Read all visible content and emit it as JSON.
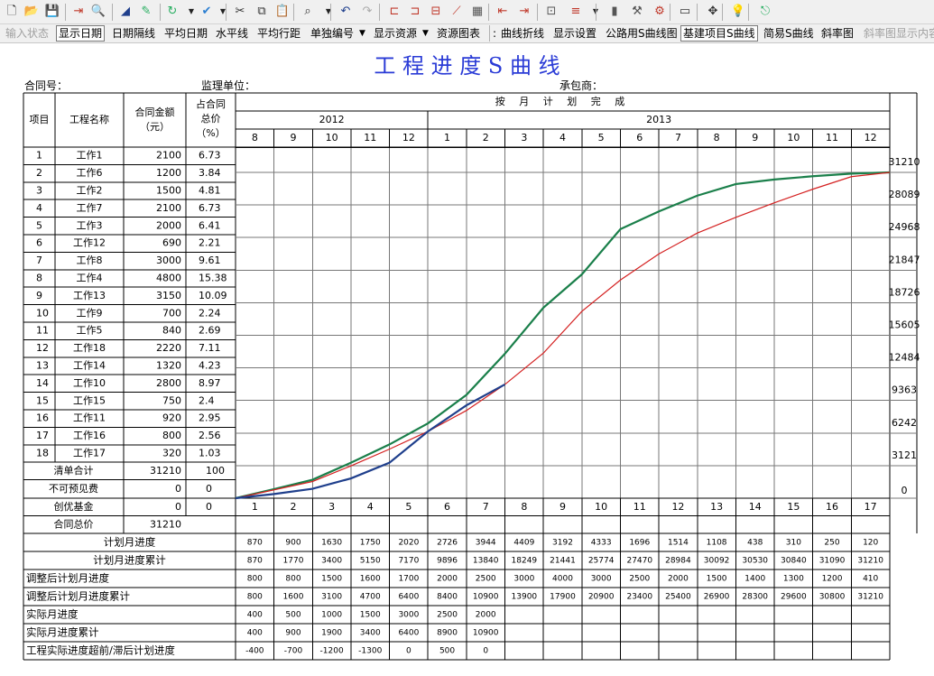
{
  "toolbar_icons": [
    "new-file-icon",
    "open-folder-icon",
    "save-icon",
    "export-icon",
    "print-preview-icon",
    "line-tool-icon",
    "pen-icon",
    "refresh-icon",
    "check-icon",
    "cut-icon",
    "copy-icon",
    "paste-icon",
    "find-icon",
    "undo-icon",
    "redo-icon",
    "bar-1-icon",
    "bar-2-icon",
    "bar-3-icon",
    "curve-icon",
    "resource-icon",
    "shift-left-icon",
    "shift-right-icon",
    "chart-icon",
    "align-icon",
    "column-chart-icon",
    "tool-1-icon",
    "tool-2-icon",
    "monitor-icon",
    "move-icon",
    "bulb-icon",
    "exit-icon"
  ],
  "menu": {
    "input_status": "输入状态",
    "show_date": "显示日期",
    "date_gap_line": "日期隔线",
    "avg_date": "平均日期",
    "hline": "水平线",
    "avg_row_dist": "平均行距",
    "single_num": "单独编号",
    "show_resource": "显示资源",
    "resource_chart": "资源图表",
    "curve_polyline": "曲线折线",
    "display_settings": "显示设置",
    "highway_s": "公路用S曲线图",
    "capital_s": "基建项目S曲线",
    "simple_s": "简易S曲线",
    "slope_chart": "斜率图",
    "slope_content": "斜率图显示内容"
  },
  "title": "工 程 进 度 S 曲 线",
  "contract_no_label": "合同号：",
  "supervisor_label": "监理单位：",
  "contractor_label": "承包商：",
  "headers": {
    "item": "项目",
    "name": "工程名称",
    "amount": "合同金额",
    "amount_unit": "（元）",
    "pct1": "占合同",
    "pct2": "总价",
    "pct3": "（%）",
    "plan": "按 月 计 划 完 成"
  },
  "years": [
    "2012",
    "2013"
  ],
  "months": [
    "8",
    "9",
    "10",
    "11",
    "12",
    "1",
    "2",
    "3",
    "4",
    "5",
    "6",
    "7",
    "8",
    "9",
    "10",
    "11",
    "12"
  ],
  "items": [
    {
      "no": "1",
      "name": "工作1",
      "amount": "2100",
      "pct": "6.73"
    },
    {
      "no": "2",
      "name": "工作6",
      "amount": "1200",
      "pct": "3.84"
    },
    {
      "no": "3",
      "name": "工作2",
      "amount": "1500",
      "pct": "4.81"
    },
    {
      "no": "4",
      "name": "工作7",
      "amount": "2100",
      "pct": "6.73"
    },
    {
      "no": "5",
      "name": "工作3",
      "amount": "2000",
      "pct": "6.41"
    },
    {
      "no": "6",
      "name": "工作12",
      "amount": "690",
      "pct": "2.21"
    },
    {
      "no": "7",
      "name": "工作8",
      "amount": "3000",
      "pct": "9.61"
    },
    {
      "no": "8",
      "name": "工作4",
      "amount": "4800",
      "pct": "15.38"
    },
    {
      "no": "9",
      "name": "工作13",
      "amount": "3150",
      "pct": "10.09"
    },
    {
      "no": "10",
      "name": "工作9",
      "amount": "700",
      "pct": "2.24"
    },
    {
      "no": "11",
      "name": "工作5",
      "amount": "840",
      "pct": "2.69"
    },
    {
      "no": "12",
      "name": "工作18",
      "amount": "2220",
      "pct": "7.11"
    },
    {
      "no": "13",
      "name": "工作14",
      "amount": "1320",
      "pct": "4.23"
    },
    {
      "no": "14",
      "name": "工作10",
      "amount": "2800",
      "pct": "8.97"
    },
    {
      "no": "15",
      "name": "工作15",
      "amount": "750",
      "pct": "2.4"
    },
    {
      "no": "16",
      "name": "工作11",
      "amount": "920",
      "pct": "2.95"
    },
    {
      "no": "17",
      "name": "工作16",
      "amount": "800",
      "pct": "2.56"
    },
    {
      "no": "18",
      "name": "工作17",
      "amount": "320",
      "pct": "1.03"
    }
  ],
  "summary": [
    {
      "label": "清单合计",
      "amount": "31210",
      "pct": "100"
    },
    {
      "label": "不可预见费",
      "amount": "0",
      "pct": "0"
    },
    {
      "label": "创优基金",
      "amount": "0",
      "pct": "0"
    },
    {
      "label": "合同总价",
      "amount": "31210",
      "pct": ""
    }
  ],
  "period_nums": [
    "1",
    "2",
    "3",
    "4",
    "5",
    "6",
    "7",
    "8",
    "9",
    "10",
    "11",
    "12",
    "13",
    "14",
    "15",
    "16",
    "17"
  ],
  "y_ticks": [
    "31210",
    "28089",
    "24968",
    "21847",
    "18726",
    "15605",
    "12484",
    "9363",
    "6242",
    "3121",
    "0"
  ],
  "bottom_rows": [
    {
      "label": "计划月进度",
      "values": [
        "870",
        "900",
        "1630",
        "1750",
        "2020",
        "2726",
        "3944",
        "4409",
        "3192",
        "4333",
        "1696",
        "1514",
        "1108",
        "438",
        "310",
        "250",
        "120"
      ]
    },
    {
      "label": "计划月进度累计",
      "values": [
        "870",
        "1770",
        "3400",
        "5150",
        "7170",
        "9896",
        "13840",
        "18249",
        "21441",
        "25774",
        "27470",
        "28984",
        "30092",
        "30530",
        "30840",
        "31090",
        "31210"
      ]
    },
    {
      "label": "调整后计划月进度",
      "values": [
        "800",
        "800",
        "1500",
        "1600",
        "1700",
        "2000",
        "2500",
        "3000",
        "4000",
        "3000",
        "2500",
        "2000",
        "1500",
        "1400",
        "1300",
        "1200",
        "410"
      ]
    },
    {
      "label": "调整后计划月进度累计",
      "values": [
        "800",
        "1600",
        "3100",
        "4700",
        "6400",
        "8400",
        "10900",
        "13900",
        "17900",
        "20900",
        "23400",
        "25400",
        "26900",
        "28300",
        "29600",
        "30800",
        "31210"
      ]
    },
    {
      "label": "实际月进度",
      "values": [
        "400",
        "500",
        "1000",
        "1500",
        "3000",
        "2500",
        "2000",
        "",
        "",
        "",
        "",
        "",
        "",
        "",
        "",
        "",
        ""
      ]
    },
    {
      "label": "实际月进度累计",
      "values": [
        "400",
        "900",
        "1900",
        "3400",
        "6400",
        "8900",
        "10900",
        "",
        "",
        "",
        "",
        "",
        "",
        "",
        "",
        "",
        ""
      ]
    },
    {
      "label": "工程实际进度超前/滞后计划进度",
      "values": [
        "-400",
        "-700",
        "-1200",
        "-1300",
        "0",
        "500",
        "0",
        "",
        "",
        "",
        "",
        "",
        "",
        "",
        "",
        "",
        ""
      ]
    }
  ],
  "chart_data": {
    "type": "line",
    "x": [
      1,
      2,
      3,
      4,
      5,
      6,
      7,
      8,
      9,
      10,
      11,
      12,
      13,
      14,
      15,
      16,
      17
    ],
    "ylim": [
      0,
      31210
    ],
    "series": [
      {
        "values": [
          870,
          1770,
          3400,
          5150,
          7170,
          9896,
          13840,
          18249,
          21441,
          25774,
          27470,
          28984,
          30092,
          30530,
          30840,
          31090,
          31210
        ],
        "color": "#1a7f4a"
      },
      {
        "values": [
          800,
          1600,
          3100,
          4700,
          6400,
          8400,
          10900,
          13900,
          17900,
          20900,
          23400,
          25400,
          26900,
          28300,
          29600,
          30800,
          31210
        ],
        "color": "#d42020"
      },
      {
        "values": [
          400,
          900,
          1900,
          3400,
          6400,
          8900,
          10900
        ],
        "color": "#1f3f8c"
      }
    ]
  }
}
